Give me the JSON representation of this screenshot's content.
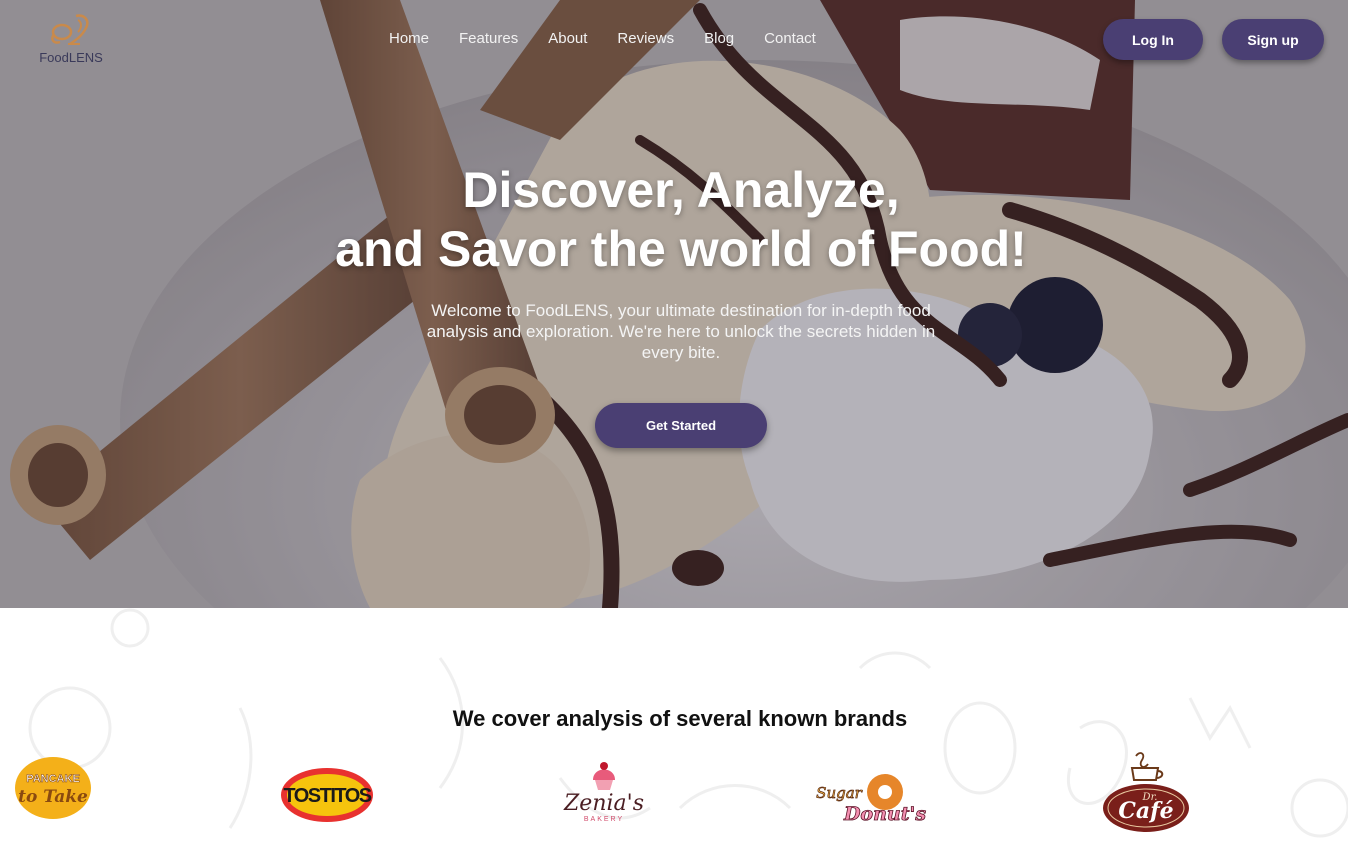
{
  "brand": {
    "name": "FoodLENS",
    "logo_icon": "spoon-whisk-logo-icon"
  },
  "nav": {
    "items": [
      {
        "label": "Home"
      },
      {
        "label": "Features"
      },
      {
        "label": "About"
      },
      {
        "label": "Reviews"
      },
      {
        "label": "Blog"
      },
      {
        "label": "Contact"
      }
    ]
  },
  "auth": {
    "login_label": "Log In",
    "signup_label": "Sign up"
  },
  "hero": {
    "title_line1": "Discover, Analyze,",
    "title_line2": "and Savor the world of Food!",
    "subtitle": "Welcome to FoodLENS, your ultimate destination for in-depth food analysis and exploration. We're here to unlock the secrets hidden in every bite.",
    "cta_label": "Get Started",
    "background": "banana-dessert-with-chocolate-and-wafer-rolls"
  },
  "brands_section": {
    "title": "We cover analysis of several known brands",
    "logos": [
      {
        "name": "Pancake To Take",
        "line1": "PANCAKE",
        "line2": "to Take"
      },
      {
        "name": "Tostitos",
        "text": "TOSTITOS"
      },
      {
        "name": "Zenia's Bakery",
        "line1": "Zenia's",
        "line2": "BAKERY"
      },
      {
        "name": "Sugar Donut's",
        "line1": "Sugar",
        "line2": "Donut's"
      },
      {
        "name": "Dr Cafe",
        "line1": "Dr.",
        "line2": "Café"
      }
    ]
  },
  "colors": {
    "accent": "#4a3f73",
    "logo_orange": "#c98a4b",
    "hero_overlay": "rgba(40,35,60,0.35)"
  }
}
